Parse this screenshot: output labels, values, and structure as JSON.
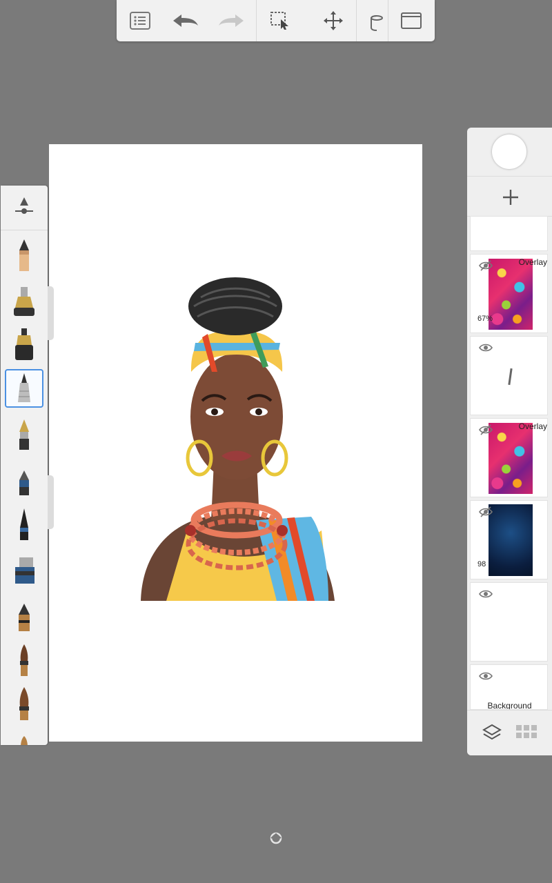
{
  "toolbar": {
    "icons": [
      "list-icon",
      "undo-icon",
      "redo-icon",
      "selection-icon",
      "move-icon",
      "fill-icon",
      "fullscreen-icon"
    ]
  },
  "brushes": {
    "selected_index": 3,
    "items": [
      "brush-settings",
      "pencil",
      "marker",
      "ink-pen",
      "airbrush",
      "fountain-pen",
      "felt-tip",
      "fine-liner",
      "chisel-marker",
      "hard-pencil",
      "paint-brush",
      "flat-brush",
      "soft-brush"
    ]
  },
  "layers": {
    "add_label": "+",
    "items": [
      {
        "blend": "Overlay",
        "opacity": "67%"
      },
      {
        "blend": "",
        "opacity": ""
      },
      {
        "blend": "Overlay",
        "opacity": ""
      },
      {
        "blend": "",
        "opacity": "98"
      },
      {
        "blend": "",
        "opacity": ""
      },
      {
        "name": "Background"
      }
    ]
  },
  "colors": {
    "accent": "#4a90e2",
    "panel": "#f1f1f1",
    "backdrop": "#7a7a7a"
  }
}
